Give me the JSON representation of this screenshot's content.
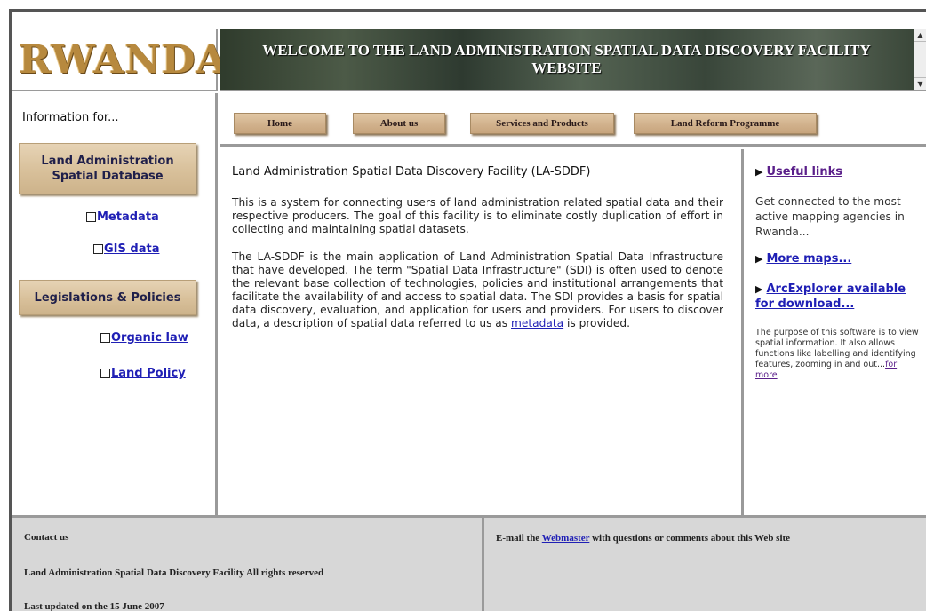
{
  "header": {
    "logo_text": "RWANDA",
    "banner_title": "WELCOME TO THE LAND ADMINISTRATION SPATIAL DATA DISCOVERY FACILITY WEBSITE"
  },
  "sidebar": {
    "heading": "Information for...",
    "lasd_button": "Land Administration Spatial Database",
    "metadata_link": "Metadata",
    "gis_link": "GIS data",
    "legislations_button": "Legislations & Policies",
    "organic_law_link": "Organic law",
    "land_policy_link": "Land Policy"
  },
  "nav": {
    "items": [
      {
        "label": "Home"
      },
      {
        "label": "About us"
      },
      {
        "label": "Services and Products"
      },
      {
        "label": "Land Reform Programme"
      }
    ]
  },
  "main": {
    "title": "Land Administration Spatial Data Discovery Facility (LA-SDDF)",
    "para1": "This is a system for connecting users of land administration related spatial data and their respective producers. The goal of this facility is to eliminate costly duplication of effort in collecting and maintaining spatial datasets.",
    "para2_before_link": "The LA-SDDF is the main application of Land Administration Spatial Data Infrastructure that have developed. The term \"Spatial Data Infrastructure\" (SDI) is often used to denote the relevant base collection of technologies, policies and institutional arrangements that facilitate the availability of and access to spatial data. The SDI provides a basis for spatial data discovery, evaluation, and application for users and providers. For users to discover data, a description of spatial data referred to us as",
    "para2_link": "metadata",
    "para2_after_link": "is provided."
  },
  "right": {
    "useful_links": "Useful links",
    "connect_text": "Get connected to the most active mapping agencies in Rwanda...",
    "more_maps": "More maps...",
    "arcexplorer": "ArcExplorer available for download...",
    "arc_desc": "The purpose of this software is to view spatial information. It also allows functions like labelling and identifying features, zooming in and out...",
    "for_more": "for more"
  },
  "footer": {
    "contact": "Contact us",
    "rights": "Land Administration Spatial Data Discovery Facility All rights reserved",
    "updated": "Last updated on the 15 June 2007",
    "email_before": "E-mail the",
    "webmaster": "Webmaster",
    "email_after": "with questions or comments about this Web site"
  },
  "colors": {
    "button_tan": "#d8c09a",
    "link_blue": "#1f1fb5",
    "visited_purple": "#5a1f8a",
    "footer_gray": "#d7d7d7"
  }
}
